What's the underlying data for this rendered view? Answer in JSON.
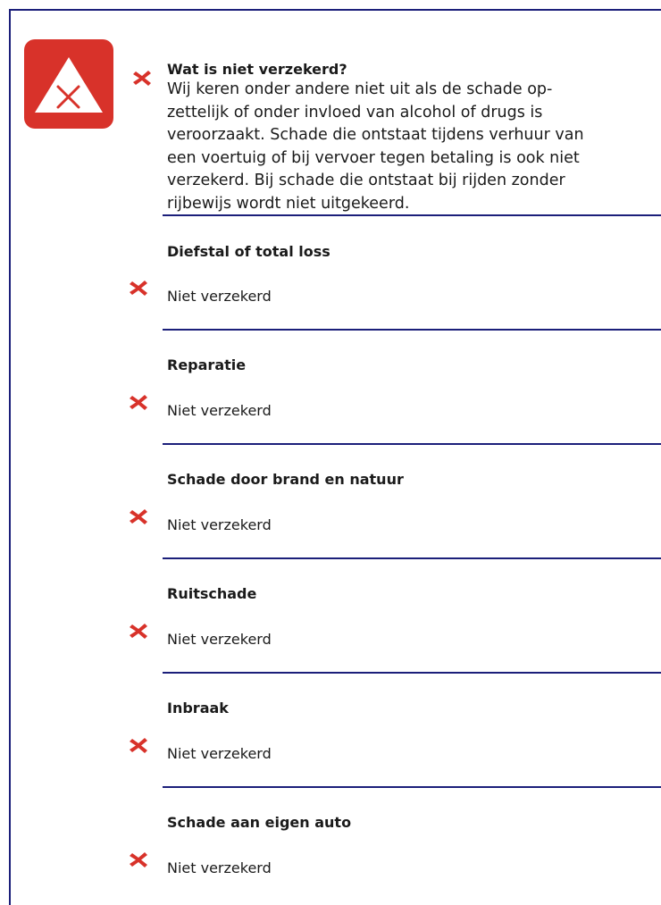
{
  "header": {
    "title": "Wat is niet verzekerd?",
    "intro": "Wij keren onder andere niet uit als de schade op-\nzettelijk of onder invloed van alcohol of drugs is\nveroorzaakt. Schade die ontstaat tijdens verhuur van\neen voertuig of bij vervoer tegen betaling is ook niet\nverzekerd. Bij schade die ontstaat bij rijden zonder\nrijbewijs wordt niet uitgekeerd."
  },
  "sections": [
    {
      "title": "Diefstal of total loss",
      "status": "Niet verzekerd"
    },
    {
      "title": "Reparatie",
      "status": "Niet verzekerd"
    },
    {
      "title": "Schade door brand en natuur",
      "status": "Niet verzekerd"
    },
    {
      "title": "Ruitschade",
      "status": "Niet verzekerd"
    },
    {
      "title": "Inbraak",
      "status": "Niet verzekerd"
    },
    {
      "title": "Schade aan eigen auto",
      "status": "Niet verzekerd"
    }
  ],
  "icons": {
    "badge": "warning-triangle-x-icon",
    "status": "cross-icon"
  },
  "colors": {
    "accent_red": "#d8322a",
    "rule_blue": "#1b1f7a"
  }
}
